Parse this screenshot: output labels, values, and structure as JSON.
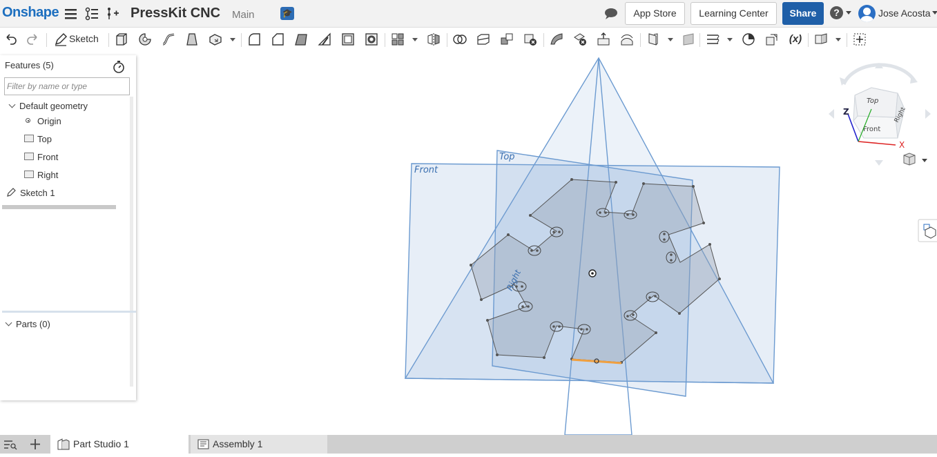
{
  "header": {
    "logo": "Onshape",
    "document_title": "PressKit CNC",
    "branch": "Main",
    "app_store": "App Store",
    "learning_center": "Learning Center",
    "share": "Share",
    "help": "?",
    "user_name": "Jose Acosta"
  },
  "toolbar": {
    "sketch_label": "Sketch",
    "variable_label": "(x)"
  },
  "feature_panel": {
    "title": "Features (5)",
    "filter_placeholder": "Filter by name or type",
    "tree": {
      "default_geometry": "Default geometry",
      "origin": "Origin",
      "top": "Top",
      "front": "Front",
      "right": "Right",
      "sketch": "Sketch 1"
    },
    "parts": "Parts (0)"
  },
  "viewport": {
    "plane_labels": {
      "front": "Front",
      "top": "Top",
      "right": "Right"
    },
    "view_cube": {
      "top": "Top",
      "front": "Front",
      "right": "Right",
      "axis_x": "X",
      "axis_z": "Z"
    }
  },
  "tabs": [
    {
      "label": "Part Studio 1",
      "active": true
    },
    {
      "label": "Assembly 1",
      "active": false
    }
  ],
  "colors": {
    "brand_blue": "#1d6fbf",
    "share_blue": "#1f5fa8",
    "plane_blue": "#4f86c0",
    "selected_edge": "#f0a040",
    "axis_x": "#d22",
    "axis_y": "#2a2",
    "axis_z": "#22c"
  }
}
